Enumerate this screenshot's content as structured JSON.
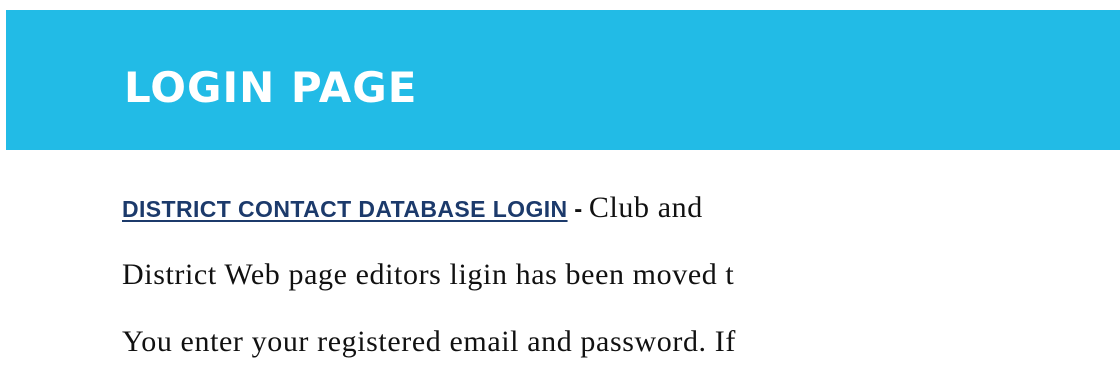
{
  "header": {
    "title": "LOGIN PAGE",
    "background_color": "#22bbe6"
  },
  "content": {
    "link_text": "DISTRICT CONTACT DATABASE LOGIN",
    "separator": " - ",
    "line1_text": "Club and",
    "line2_text": "District Web page editors ligin has been moved t",
    "line3_text": "You enter your registered email and password. If"
  }
}
